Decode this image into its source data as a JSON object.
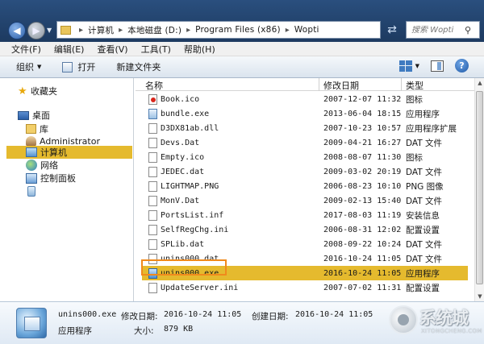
{
  "address": {
    "crumbs": [
      "计算机",
      "本地磁盘 (D:)",
      "Program Files (x86)",
      "Wopti"
    ],
    "separator": "▸"
  },
  "search": {
    "placeholder": "搜索 Wopti"
  },
  "menu": [
    "文件(F)",
    "编辑(E)",
    "查看(V)",
    "工具(T)",
    "帮助(H)"
  ],
  "toolbar": {
    "organize": "组织",
    "open": "打开",
    "new_folder": "新建文件夹"
  },
  "nav": {
    "favorites": "收藏夹",
    "desktop": "桌面",
    "library": "库",
    "user": "Administrator",
    "computer": "计算机",
    "network": "网络",
    "control_panel": "控制面板"
  },
  "columns": {
    "name": "名称",
    "date": "修改日期",
    "type": "类型"
  },
  "files": [
    {
      "name": "Book.ico",
      "date": "2007-12-07 11:32",
      "type": "图标",
      "icon": "red"
    },
    {
      "name": "bundle.exe",
      "date": "2013-06-04 18:15",
      "type": "应用程序",
      "icon": "exe"
    },
    {
      "name": "D3DX81ab.dll",
      "date": "2007-10-23 10:57",
      "type": "应用程序扩展",
      "icon": "file"
    },
    {
      "name": "Devs.Dat",
      "date": "2009-04-21 16:27",
      "type": "DAT 文件",
      "icon": "file"
    },
    {
      "name": "Empty.ico",
      "date": "2008-08-07 11:30",
      "type": "图标",
      "icon": "file"
    },
    {
      "name": "JEDEC.dat",
      "date": "2009-03-02 20:19",
      "type": "DAT 文件",
      "icon": "file"
    },
    {
      "name": "LIGHTMAP.PNG",
      "date": "2006-08-23 10:10",
      "type": "PNG 图像",
      "icon": "file"
    },
    {
      "name": "MonV.Dat",
      "date": "2009-02-13 15:40",
      "type": "DAT 文件",
      "icon": "file"
    },
    {
      "name": "PortsList.inf",
      "date": "2017-08-03 11:19",
      "type": "安装信息",
      "icon": "file"
    },
    {
      "name": "SelfRegChg.ini",
      "date": "2006-08-31 12:02",
      "type": "配置设置",
      "icon": "file"
    },
    {
      "name": "SPLib.dat",
      "date": "2008-09-22 10:24",
      "type": "DAT 文件",
      "icon": "file"
    },
    {
      "name": "unins000.dat",
      "date": "2016-10-24 11:05",
      "type": "DAT 文件",
      "icon": "file"
    },
    {
      "name": "unins000.exe",
      "date": "2016-10-24 11:05",
      "type": "应用程序",
      "icon": "setup",
      "selected": true
    },
    {
      "name": "UpdateServer.ini",
      "date": "2007-07-02 11:31",
      "type": "配置设置",
      "icon": "file"
    }
  ],
  "details": {
    "filename": "unins000.exe",
    "filetype": "应用程序",
    "modified_label": "修改日期:",
    "modified_value": "2016-10-24 11:05",
    "created_label": "创建日期:",
    "created_value": "2016-10-24 11:05",
    "size_label": "大小:",
    "size_value": "879 KB"
  },
  "watermark": {
    "title": "系统城",
    "sub": "XITONGCHENG.COM"
  }
}
